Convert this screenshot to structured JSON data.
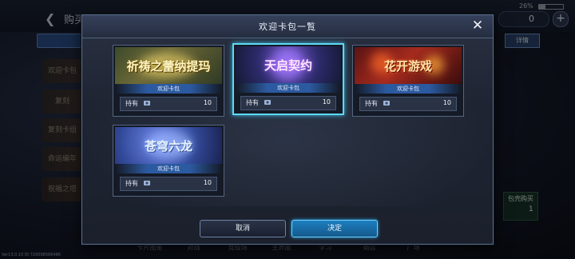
{
  "background": {
    "title": "购买",
    "battery": "26%",
    "currency_value": "0",
    "detail_button": "详情",
    "side_items": [
      "欢迎卡包",
      "复刻",
      "复刻卡组",
      "命运编年",
      "祝福之塔"
    ],
    "right_panel_label": "包壳购买",
    "right_panel_count": "1",
    "bottom_nav": [
      "卡片图鉴",
      "对战",
      "竞技场",
      "主界面",
      "学习",
      "商店",
      "广场"
    ],
    "version": "Ver13.0.10 ID 720098566486"
  },
  "modal": {
    "title": "欢迎卡包一覧",
    "close_icon": "close-x",
    "packs": [
      {
        "name": "祈祷之蕾纳提玛",
        "subtitle": "欢迎卡包",
        "own_label": "持有",
        "count": "10",
        "selected": false
      },
      {
        "name": "天启契约",
        "subtitle": "欢迎卡包",
        "own_label": "持有",
        "count": "10",
        "selected": true
      },
      {
        "name": "花开游戏",
        "subtitle": "欢迎卡包",
        "own_label": "持有",
        "count": "10",
        "selected": false
      },
      {
        "name": "苍穹六龙",
        "subtitle": "欢迎卡包",
        "own_label": "持有",
        "count": "10",
        "selected": false
      }
    ],
    "cancel_label": "取消",
    "ok_label": "决定"
  },
  "colors": {
    "selected_border": "#5fd8f4",
    "ok_button": "#1e7fbf",
    "modal_border": "#59708f"
  }
}
